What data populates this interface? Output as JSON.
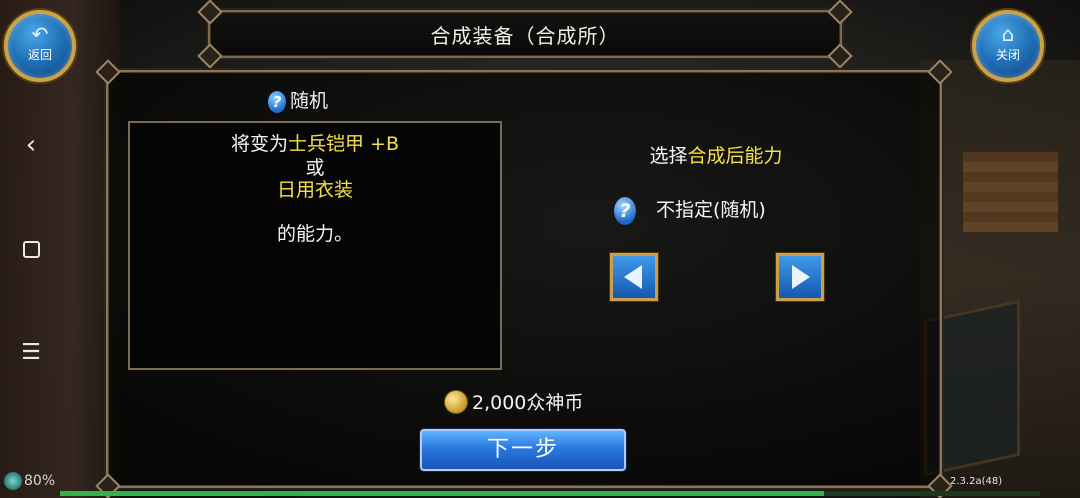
{
  "window": {
    "title": "合成装备（合成所）"
  },
  "top_buttons": {
    "back_label": "返回",
    "close_label": "关闭"
  },
  "left_panel": {
    "random_label": "随机",
    "info_line1_prefix": "将变为",
    "info_item1": "士兵铠甲 +B",
    "info_or": "或",
    "info_item2": "日用衣装",
    "info_suffix": "的能力。"
  },
  "right_panel": {
    "select_title_prefix": "选择",
    "select_title_highlight": "合成后能力",
    "option_label": "不指定(随机)"
  },
  "cost": {
    "amount": "2,000众神币"
  },
  "actions": {
    "next_label": "下一步"
  },
  "status": {
    "battery": "80%",
    "version": "2.3.2a(48)",
    "progress_fraction": 0.78
  },
  "colors": {
    "highlight": "#f5e04a",
    "button_blue": "#2a78e0",
    "frame_gold": "#c9a24a"
  },
  "icons": {
    "help": "question-icon",
    "coin": "coin-icon",
    "back": "back-icon",
    "home": "home-icon"
  }
}
